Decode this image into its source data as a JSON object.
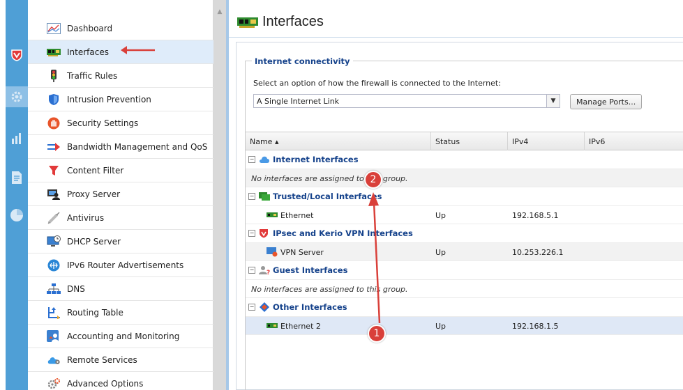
{
  "sidebar": {
    "items": [
      {
        "label": "Dashboard",
        "icon": "dashboard-chart-icon"
      },
      {
        "label": "Interfaces",
        "icon": "network-card-icon"
      },
      {
        "label": "Traffic Rules",
        "icon": "traffic-light-icon"
      },
      {
        "label": "Intrusion Prevention",
        "icon": "shield-icon"
      },
      {
        "label": "Security Settings",
        "icon": "hand-stop-icon"
      },
      {
        "label": "Bandwidth Management and QoS",
        "icon": "arrows-icon"
      },
      {
        "label": "Content Filter",
        "icon": "funnel-icon"
      },
      {
        "label": "Proxy Server",
        "icon": "proxy-icon"
      },
      {
        "label": "Antivirus",
        "icon": "syringe-icon"
      },
      {
        "label": "DHCP Server",
        "icon": "monitor-clock-icon"
      },
      {
        "label": "IPv6 Router Advertisements",
        "icon": "router-icon"
      },
      {
        "label": "DNS",
        "icon": "dns-tree-icon"
      },
      {
        "label": "Routing Table",
        "icon": "routing-icon"
      },
      {
        "label": "Accounting and Monitoring",
        "icon": "user-chart-icon"
      },
      {
        "label": "Remote Services",
        "icon": "cloud-gear-icon"
      },
      {
        "label": "Advanced Options",
        "icon": "gears-icon"
      }
    ]
  },
  "main": {
    "title": "Interfaces",
    "connectivity": {
      "legend": "Internet connectivity",
      "prompt": "Select an option of how the firewall is connected to the Internet:",
      "selected": "A Single Internet Link",
      "manage_button": "Manage Ports..."
    },
    "grid": {
      "columns": [
        "Name ▴",
        "Status",
        "IPv4",
        "IPv6"
      ],
      "groups": [
        {
          "label": "Internet Interfaces",
          "empty_text": "No interfaces are assigned to this group."
        },
        {
          "label": "Trusted/Local Interfaces",
          "row": {
            "name": "Ethernet",
            "status": "Up",
            "ipv4": "192.168.5.1"
          }
        },
        {
          "label": "IPsec and Kerio VPN Interfaces",
          "row": {
            "name": "VPN Server",
            "status": "Up",
            "ipv4": "10.253.226.1"
          }
        },
        {
          "label": "Guest Interfaces",
          "empty_text": "No interfaces are assigned to this group."
        },
        {
          "label": "Other Interfaces",
          "row": {
            "name": "Ethernet 2",
            "status": "Up",
            "ipv4": "192.168.1.5"
          }
        }
      ]
    }
  },
  "annotations": {
    "badge1": "1",
    "badge2": "2"
  },
  "colors": {
    "accent": "#4f9fd6",
    "group_text": "#15428b",
    "annotation": "#d9403a"
  }
}
